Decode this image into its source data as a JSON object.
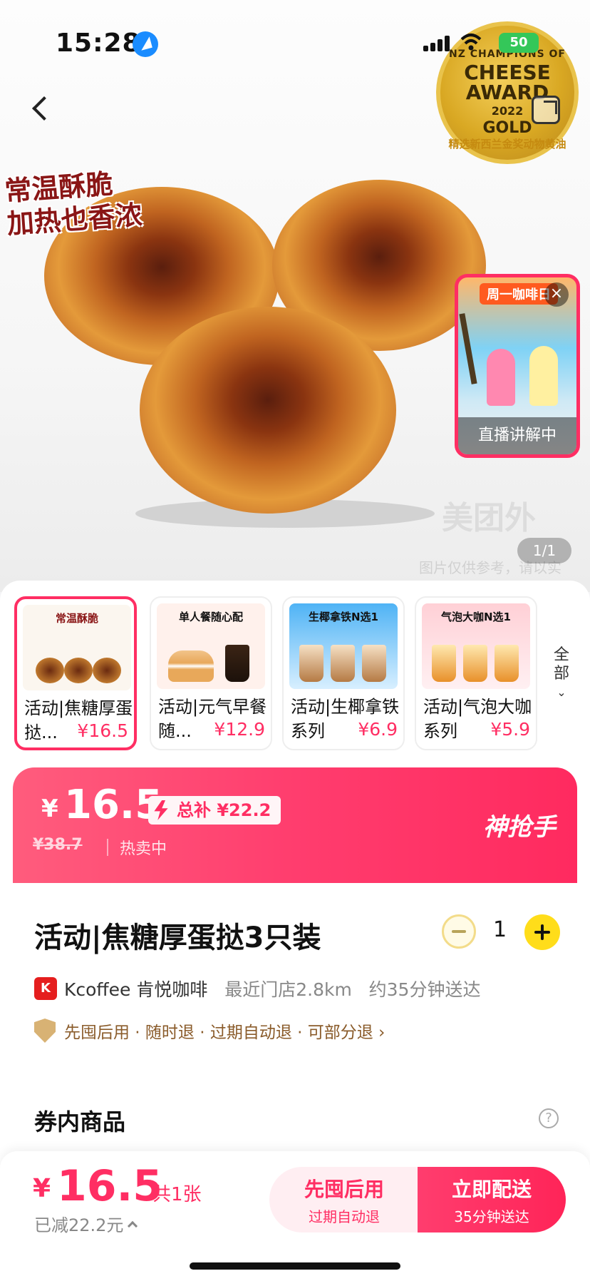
{
  "status_bar": {
    "time": "15:28",
    "battery": "50"
  },
  "hero": {
    "slogan_line1": "常温酥脆",
    "slogan_line2": "加热也香浓",
    "award": {
      "top": "NZ CHAMPIONS OF",
      "main1": "CHEESE",
      "main2": "AWARD",
      "year": "2022",
      "grade": "GOLD",
      "ring": "精选新西兰金奖动物黄油"
    },
    "live": {
      "banner": "周一咖啡日",
      "caption": "直播讲解中"
    },
    "watermark": "美团外",
    "watermark_sub": "图片仅供参考，请以实",
    "page_indicator": "1/1"
  },
  "variants": [
    {
      "thumb_title": "常温酥脆",
      "name": "活动|焦糖厚蛋挞...",
      "price": "¥16.5",
      "selected": true
    },
    {
      "thumb_title": "单人餐随心配",
      "name": "活动|元气早餐随...",
      "price": "¥12.9",
      "selected": false
    },
    {
      "thumb_title": "生椰拿铁N选1",
      "name": "活动|生椰拿铁系列",
      "price": "¥6.9",
      "selected": false
    },
    {
      "thumb_title": "气泡大咖N选1",
      "name": "活动|气泡大咖系列",
      "price": "¥5.9",
      "selected": false
    }
  ],
  "all_link": "全部",
  "price_banner": {
    "currency": "¥",
    "price": "16.5",
    "subsidy": "总补 ¥22.2",
    "original_price": "¥38.7",
    "status": "热卖中",
    "brand": "神抢手"
  },
  "product": {
    "title": "活动|焦糖厚蛋挞3只装",
    "quantity": "1",
    "store_icon_text": "K",
    "store_name": "Kcoffee 肯悦咖啡",
    "store_distance": "最近门店2.8km",
    "delivery_time": "约35分钟送达",
    "guarantee": "先囤后用 · 随时退 · 过期自动退 · 可部分退 ›"
  },
  "coupon": {
    "title": "券内商品",
    "help": "?"
  },
  "bottom_bar": {
    "currency": "¥",
    "price": "16.5",
    "count": "共1张",
    "saved": "已减22.2元",
    "later_main": "先囤后用",
    "later_sub": "过期自动退",
    "now_main": "立即配送",
    "now_sub": "35分钟送达"
  },
  "colors": {
    "accent": "#ff2e63",
    "plus": "#ffdd1a",
    "gold": "#d9a823"
  },
  "icons": [
    "location-icon",
    "signal-icon",
    "wifi-icon",
    "back-icon",
    "share-icon",
    "close-icon",
    "bolt-icon",
    "minus-icon",
    "plus-icon",
    "shield-icon",
    "help-icon",
    "chevron-up-icon"
  ]
}
